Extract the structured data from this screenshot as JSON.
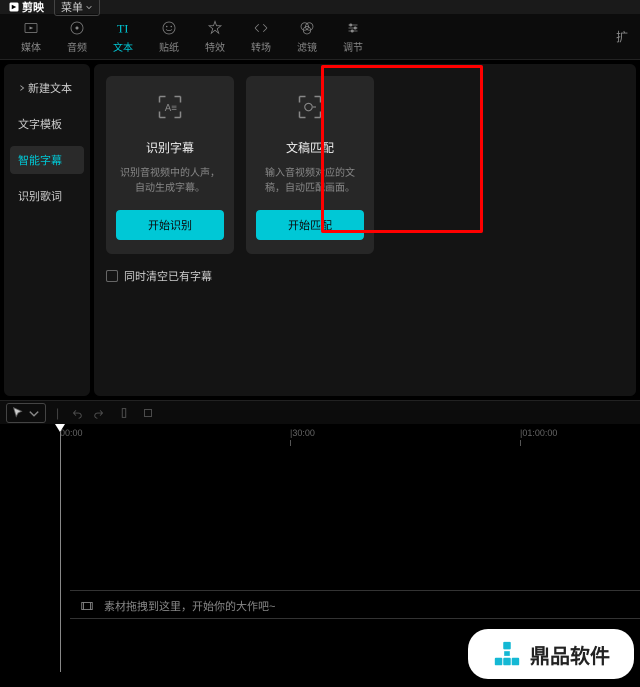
{
  "titlebar": {
    "app_name": "剪映",
    "menu_label": "菜单"
  },
  "toolbar": {
    "items": [
      {
        "label": "媒体"
      },
      {
        "label": "音频"
      },
      {
        "label": "文本"
      },
      {
        "label": "贴纸"
      },
      {
        "label": "特效"
      },
      {
        "label": "转场"
      },
      {
        "label": "滤镜"
      },
      {
        "label": "调节"
      }
    ],
    "right_label": "扩"
  },
  "sidebar": {
    "items": [
      {
        "label": "新建文本"
      },
      {
        "label": "文字模板"
      },
      {
        "label": "智能字幕"
      },
      {
        "label": "识别歌词"
      }
    ]
  },
  "cards": [
    {
      "title": "识别字幕",
      "desc": "识别音视频中的人声，自动生成字幕。",
      "button": "开始识别"
    },
    {
      "title": "文稿匹配",
      "desc": "输入音视频对应的文稿，自动匹配画面。",
      "button": "开始匹配"
    }
  ],
  "checkbox_label": "同时清空已有字幕",
  "timeline": {
    "ticks": [
      "00:00",
      "|30:00",
      "|01:00:00"
    ],
    "placeholder": "素材拖拽到这里，开始你的大作吧~"
  },
  "watermark": {
    "text": "鼎品软件"
  }
}
